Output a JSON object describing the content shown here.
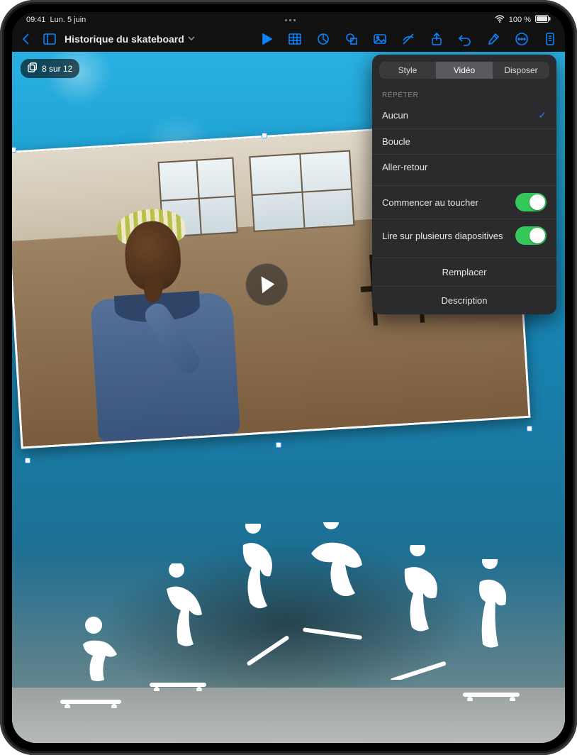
{
  "statusbar": {
    "time": "09:41",
    "date": "Lun. 5 juin",
    "battery": "100 %"
  },
  "toolbar": {
    "title": "Historique du skateboard",
    "icons": {
      "back": "chevron-left",
      "sidebar": "sidebar",
      "play": "play",
      "table": "table",
      "chart": "chart-pie",
      "shape": "shape",
      "image": "image",
      "pen": "pen-off",
      "share": "share",
      "undo": "undo",
      "format": "paintbrush",
      "more": "ellipsis",
      "doc": "document"
    }
  },
  "slide_counter": {
    "label": "8 sur 12"
  },
  "popover": {
    "tabs": {
      "style": "Style",
      "video": "Vidéo",
      "arrange": "Disposer",
      "active": "video"
    },
    "repeat_label": "RÉPÉTER",
    "repeat_options": {
      "none": "Aucun",
      "loop": "Boucle",
      "bounce": "Aller-retour",
      "selected": "none"
    },
    "toggles": {
      "start_on_touch": {
        "label": "Commencer au toucher",
        "on": true
      },
      "across_slides": {
        "label": "Lire sur plusieurs diapositives",
        "on": true
      }
    },
    "buttons": {
      "replace": "Remplacer",
      "description": "Description"
    }
  }
}
